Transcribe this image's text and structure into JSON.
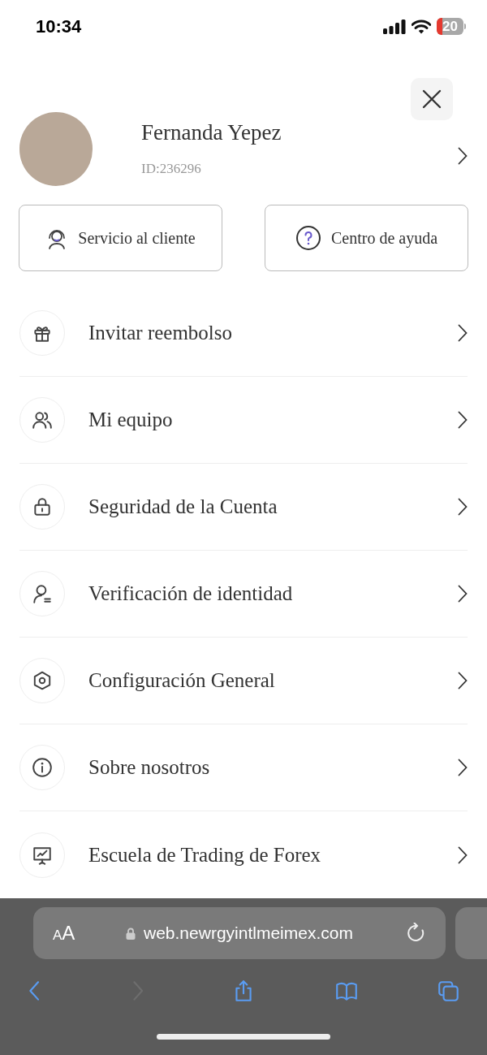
{
  "status_bar": {
    "time": "10:34",
    "battery": {
      "label": "20",
      "level": 0.2
    }
  },
  "profile": {
    "name": "Fernanda Yepez",
    "id": "ID:236296"
  },
  "quick_actions": [
    {
      "kind": "support",
      "label": "Servicio al cliente"
    },
    {
      "kind": "help",
      "label": "Centro de ayuda"
    }
  ],
  "menu": [
    {
      "kind": "gift",
      "label": "Invitar reembolso"
    },
    {
      "kind": "team",
      "label": "Mi equipo"
    },
    {
      "kind": "lock",
      "label": "Seguridad de la Cuenta"
    },
    {
      "kind": "identity",
      "label": "Verificación de identidad"
    },
    {
      "kind": "settings",
      "label": "Configuración General"
    },
    {
      "kind": "info",
      "label": "Sobre nosotros"
    },
    {
      "kind": "school",
      "label": "Escuela de Trading de Forex"
    }
  ],
  "browser": {
    "text_size": "AA",
    "url": "web.newrgyintlmeimex.com",
    "toolbar": [
      {
        "kind": "back",
        "disabled": false
      },
      {
        "kind": "forward",
        "disabled": true
      },
      {
        "kind": "share",
        "disabled": false
      },
      {
        "kind": "bookmarks",
        "disabled": false
      },
      {
        "kind": "tabs",
        "disabled": false
      }
    ]
  }
}
